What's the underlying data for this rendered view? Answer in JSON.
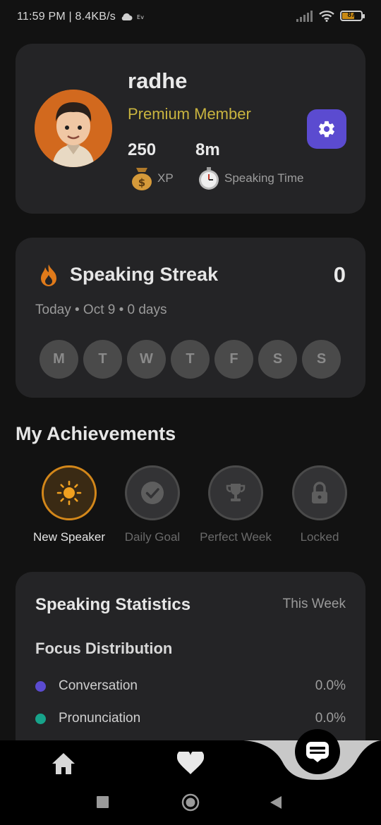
{
  "status_bar": {
    "time_speed": "11:59 PM | 8.4KB/s",
    "battery": "87"
  },
  "profile": {
    "username": "radhe",
    "membership": "Premium Member",
    "xp_value": "250",
    "xp_label": "XP",
    "time_value": "8m",
    "time_label": "Speaking Time",
    "settings_icon": "gear-icon"
  },
  "streak": {
    "title": "Speaking Streak",
    "count": "0",
    "subtitle": "Today • Oct 9 • 0 days",
    "days": [
      "M",
      "T",
      "W",
      "T",
      "F",
      "S",
      "S"
    ]
  },
  "achievements": {
    "title": "My Achievements",
    "items": [
      {
        "label": "New Speaker",
        "icon": "sun-icon",
        "active": true
      },
      {
        "label": "Daily Goal",
        "icon": "check-circle-icon",
        "active": false
      },
      {
        "label": "Perfect Week",
        "icon": "trophy-icon",
        "active": false
      },
      {
        "label": "Locked",
        "icon": "lock-icon",
        "active": false
      }
    ]
  },
  "statistics": {
    "title": "Speaking Statistics",
    "period": "This Week",
    "focus_title": "Focus Distribution",
    "focus": [
      {
        "name": "Conversation",
        "value": "0.0%",
        "color": "#5b4bd0"
      },
      {
        "name": "Pronunciation",
        "value": "0.0%",
        "color": "#17a38a"
      }
    ]
  },
  "colors": {
    "accent": "#5b4bd0",
    "premium": "#c9b43f",
    "achievement_active": "#d3871a"
  }
}
